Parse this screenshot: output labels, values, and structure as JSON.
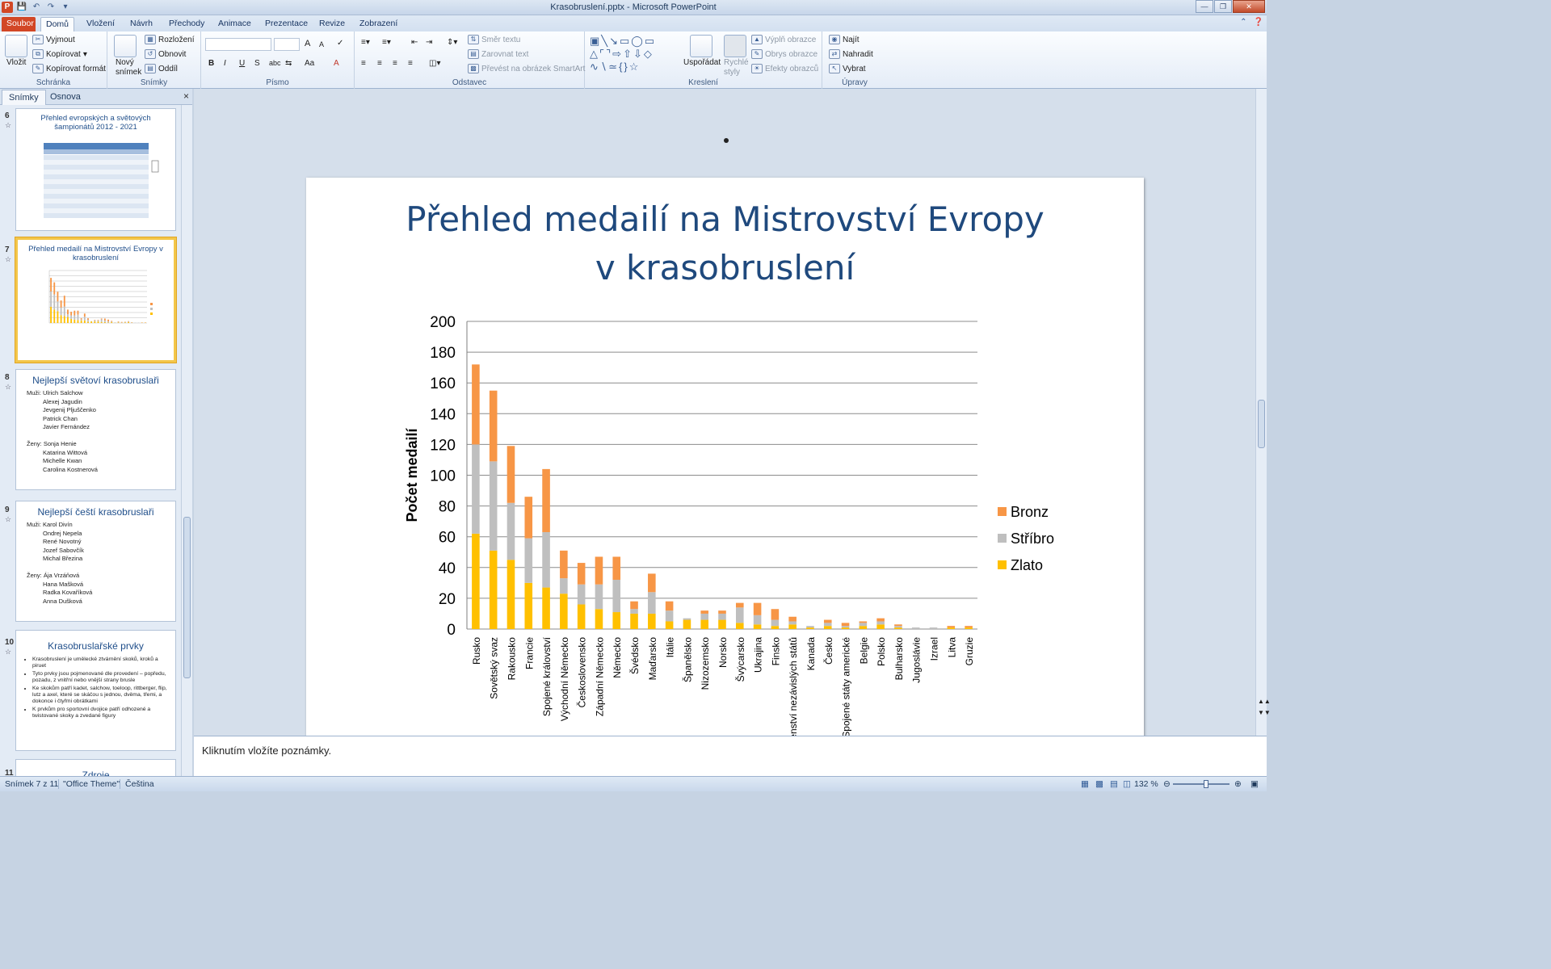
{
  "window": {
    "title": "Krasobruslení.pptx - Microsoft PowerPoint",
    "app_icon": "P"
  },
  "ribbon_tabs": [
    "Soubor",
    "Domů",
    "Vložení",
    "Návrh",
    "Přechody",
    "Animace",
    "Prezentace",
    "Revize",
    "Zobrazení"
  ],
  "ribbon": {
    "clipboard": {
      "paste": "Vložit",
      "cut": "Vyjmout",
      "copy": "Kopírovat",
      "format_painter": "Kopírovat formát",
      "label": "Schránka"
    },
    "slides": {
      "new_slide": "Nový snímek",
      "layout": "Rozložení",
      "reset": "Obnovit",
      "section": "Oddíl",
      "label": "Snímky"
    },
    "font": {
      "label": "Písmo",
      "bold": "B",
      "italic": "I",
      "underline": "U",
      "strike": "S",
      "spacing": "abc",
      "case": "Aa",
      "color": "A",
      "grow": "A",
      "shrink": "A"
    },
    "paragraph": {
      "text_direction": "Směr textu",
      "align_text": "Zarovnat text",
      "smartart": "Převést na obrázek SmartArt",
      "label": "Odstavec"
    },
    "drawing": {
      "arrange": "Uspořádat",
      "quick_styles": "Rychlé styly",
      "shape_fill": "Výplň obrazce",
      "shape_outline": "Obrys obrazce",
      "shape_effects": "Efekty obrazců",
      "label": "Kreslení"
    },
    "editing": {
      "find": "Najít",
      "replace": "Nahradit",
      "select": "Vybrat",
      "label": "Úpravy"
    }
  },
  "left_panel": {
    "tabs": [
      "Snímky",
      "Osnova"
    ],
    "close": "×",
    "thumbnails": [
      {
        "num": "6",
        "title": "Přehled evropských a světových šampionátů 2012 - 2021"
      },
      {
        "num": "7",
        "title": "Přehled medailí na Mistrovství Evropy v krasobruslení"
      },
      {
        "num": "8",
        "title": "Nejlepší světoví krasobruslaři",
        "lines": [
          "Muži: Ulrich Salchow",
          "Alexej Jagudin",
          "Jevgenij Pljuščenko",
          "Patrick Chan",
          "Javier Fernández",
          "",
          "Ženy: Sonja Henie",
          "Katarina Wittová",
          "Michelle Kwan",
          "Carolina Kostnerová"
        ]
      },
      {
        "num": "9",
        "title": "Nejlepší čeští krasobruslaři",
        "lines": [
          "Muži: Karol Divín",
          "Ondrej Nepela",
          "René Novotný",
          "Jozef Sabovčík",
          "Michal Březina",
          "",
          "Ženy: Ája Vrzáňová",
          "Hana Mašková",
          "Radka Kovaříková",
          "Anna Dušková"
        ]
      },
      {
        "num": "10",
        "title": "Krasobruslařské prvky",
        "bullets": [
          "Krasobruslení je umělecké ztvárnění skoků, kroků a piruet",
          "Tyto prvky jsou pojmenované dle provedení – popředu, pozadu, z vnitřní nebo vnější strany brusle",
          "Ke skokům patří kadet, salchow, toeloop, rittberger, flip, lutz a axel, které se skáčou s jednou, dvěma, třemi, a dokonce i čtyřmi obrátkami",
          "K prvkům pro sportovní dvojice patří odhozené a twistované skoky a zvedané figury"
        ]
      },
      {
        "num": "11",
        "title": "Zdroje"
      }
    ]
  },
  "slide": {
    "title_line1": "Přehled medailí na Mistrovství Evropy",
    "title_line2": "v krasobruslení"
  },
  "chart_data": {
    "type": "bar",
    "stacked": true,
    "title": "",
    "xlabel": "",
    "ylabel": "Počet medailí",
    "ylim": [
      0,
      200
    ],
    "yticks": [
      0,
      20,
      40,
      60,
      80,
      100,
      120,
      140,
      160,
      180,
      200
    ],
    "grid": true,
    "legend_position": "right",
    "categories": [
      "Rusko",
      "Sovětský svaz",
      "Rakousko",
      "Francie",
      "Spojené království",
      "Východní Německo",
      "Československo",
      "Západní Německo",
      "Německo",
      "Švédsko",
      "Maďarsko",
      "Itálie",
      "Španělsko",
      "Nizozemsko",
      "Norsko",
      "Švýcarsko",
      "Ukrajina",
      "Finsko",
      "Společenství nezávislých států",
      "Kanada",
      "Česko",
      "Spojené státy americké",
      "Belgie",
      "Polsko",
      "Bulharsko",
      "Jugoslávie",
      "Izrael",
      "Litva",
      "Gruzie"
    ],
    "series": [
      {
        "name": "Zlato",
        "color": "#ffc000",
        "values": [
          62,
          51,
          45,
          30,
          27,
          23,
          16,
          13,
          11,
          10,
          10,
          5,
          6,
          6,
          6,
          4,
          3,
          2,
          3,
          1,
          2,
          1,
          2,
          3,
          1,
          0,
          0,
          1,
          1
        ]
      },
      {
        "name": "Stříbro",
        "color": "#bfbfbf",
        "values": [
          58,
          58,
          37,
          29,
          36,
          10,
          13,
          16,
          21,
          3,
          14,
          7,
          1,
          4,
          4,
          10,
          6,
          4,
          2,
          1,
          2,
          1,
          2,
          2,
          1,
          1,
          1,
          0,
          0
        ]
      },
      {
        "name": "Bronz",
        "color": "#f79646",
        "values": [
          52,
          46,
          37,
          27,
          41,
          18,
          14,
          18,
          15,
          5,
          12,
          6,
          0,
          2,
          2,
          3,
          8,
          7,
          3,
          0,
          2,
          2,
          1,
          2,
          1,
          0,
          0,
          1,
          1
        ]
      }
    ]
  },
  "notes": {
    "placeholder": "Kliknutím vložíte poznámky."
  },
  "status": {
    "slide": "Snímek 7 z 11",
    "theme": "\"Office Theme\"",
    "language": "Čeština",
    "zoom": "132 %"
  }
}
